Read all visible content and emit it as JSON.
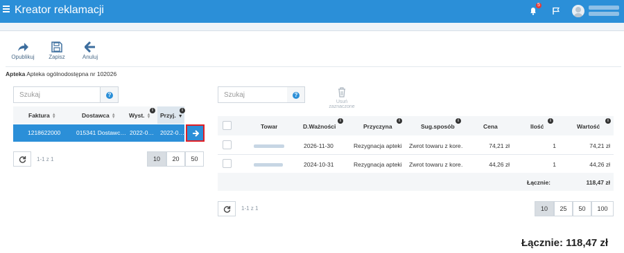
{
  "app": {
    "title": "Kreator reklamacji",
    "notification_count": "5"
  },
  "toolbar": {
    "publish": "Opublikuj",
    "save": "Zapisz",
    "cancel": "Anuluj"
  },
  "pharmacy": {
    "label": "Apteka",
    "value": "Apteka ogólnodostępna nr 102026"
  },
  "left_panel": {
    "search_placeholder": "Szukaj",
    "help": "?",
    "columns": [
      "Faktura",
      "Dostawca",
      "Wyst.",
      "Przyj."
    ],
    "rows": [
      {
        "faktura": "1218622000",
        "dostawca": "015341 Dostawc…",
        "wyst": "2022-0…",
        "przyj": "2022-0…"
      }
    ],
    "pager_info": "1-1 z 1",
    "page_sizes": [
      "10",
      "20",
      "50"
    ],
    "active_page_size": "10"
  },
  "right_panel": {
    "search_placeholder": "Szukaj",
    "help": "?",
    "delete_selected": "Usuń zaznaczone",
    "columns": [
      "Towar",
      "D.Ważności",
      "Przyczyna",
      "Sug.sposób",
      "Cena",
      "Ilość",
      "Wartość"
    ],
    "rows": [
      {
        "towar": "",
        "data": "2026-11-30",
        "przyczyna": "Rezygnacja apteki",
        "sposob": "Zwrot towaru z kore…",
        "cena": "74,21 zł",
        "ilosc": "1",
        "wartosc": "74,21 zł"
      },
      {
        "towar": "",
        "data": "2024-10-31",
        "przyczyna": "Rezygnacja apteki",
        "sposob": "Zwrot towaru z kore…",
        "cena": "44,26 zł",
        "ilosc": "1",
        "wartosc": "44,26 zł"
      }
    ],
    "total_label": "Łącznie:",
    "total_value": "118,47 zł",
    "pager_info": "1-1 z 1",
    "page_sizes": [
      "10",
      "25",
      "50",
      "100"
    ],
    "active_page_size": "10"
  },
  "grand_total": "Łącznie: 118,47 zł"
}
